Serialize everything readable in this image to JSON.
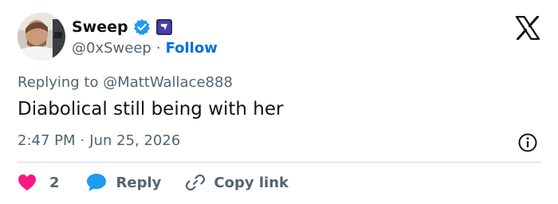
{
  "author": {
    "display_name": "Sweep",
    "handle": "@0xSweep",
    "separator": "·",
    "follow_label": "Follow"
  },
  "tweet": {
    "replying_to": "Replying to @MattWallace888",
    "text": "Diabolical still being with her",
    "time": "2:47 PM",
    "date": "Jun 25, 2026",
    "meta_separator": "·"
  },
  "actions": {
    "like_count": "2",
    "reply_label": "Reply",
    "copy_link_label": "Copy link"
  },
  "colors": {
    "accent": "#006fd6",
    "verified": "#1d9bf0",
    "like": "#f91880",
    "muted": "#536471",
    "text": "#0f1419",
    "divider": "#cfd9de"
  },
  "icons": [
    "verified-badge-icon",
    "affiliate-badge-icon",
    "x-logo-icon",
    "info-icon",
    "heart-icon",
    "reply-bubble-icon",
    "link-icon"
  ]
}
